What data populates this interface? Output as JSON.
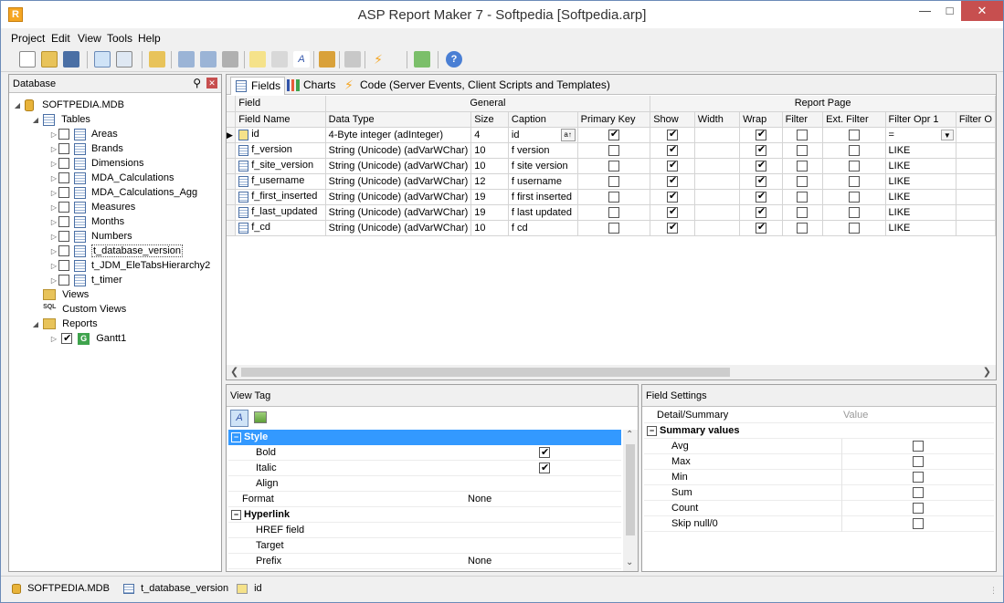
{
  "window": {
    "title": "ASP Report Maker 7 - Softpedia [Softpedia.arp]"
  },
  "menu": [
    "Project",
    "Edit",
    "View",
    "Tools",
    "Help"
  ],
  "left_panel": {
    "title": "Database",
    "root": "SOFTPEDIA.MDB",
    "tables_label": "Tables",
    "tables": [
      "Areas",
      "Brands",
      "Dimensions",
      "MDA_Calculations",
      "MDA_Calculations_Agg",
      "Measures",
      "Months",
      "Numbers",
      "t_database_version",
      "t_JDM_EleTabsHierarchy2",
      "t_timer"
    ],
    "views_label": "Views",
    "custom_views_label": "Custom Views",
    "reports_label": "Reports",
    "reports": [
      "Gantt1"
    ],
    "sql_icon_text": "SQL",
    "report_badge": "G"
  },
  "tabs": [
    {
      "label": "Fields"
    },
    {
      "label": "Charts"
    },
    {
      "label": "Code (Server Events, Client Scripts and Templates)"
    }
  ],
  "grid": {
    "group_headers": {
      "field": "Field",
      "general": "General",
      "report_page": "Report Page"
    },
    "columns": [
      "Field Name",
      "Data Type",
      "Size",
      "Caption",
      "Primary Key",
      "Show",
      "Width",
      "Wrap",
      "Filter",
      "Ext. Filter",
      "Filter Opr 1",
      "Filter O"
    ],
    "rows": [
      {
        "name": "id",
        "type": "4-Byte integer (adInteger)",
        "size": "4",
        "caption": "id",
        "pk": true,
        "show": true,
        "wrap": true,
        "filter": false,
        "extfilter": false,
        "opr": "="
      },
      {
        "name": "f_version",
        "type": "String (Unicode) (adVarWChar)",
        "size": "10",
        "caption": "f version",
        "pk": false,
        "show": true,
        "wrap": true,
        "filter": false,
        "extfilter": false,
        "opr": "LIKE"
      },
      {
        "name": "f_site_version",
        "type": "String (Unicode) (adVarWChar)",
        "size": "10",
        "caption": "f site version",
        "pk": false,
        "show": true,
        "wrap": true,
        "filter": false,
        "extfilter": false,
        "opr": "LIKE"
      },
      {
        "name": "f_username",
        "type": "String (Unicode) (adVarWChar)",
        "size": "12",
        "caption": "f username",
        "pk": false,
        "show": true,
        "wrap": true,
        "filter": false,
        "extfilter": false,
        "opr": "LIKE"
      },
      {
        "name": "f_first_inserted",
        "type": "String (Unicode) (adVarWChar)",
        "size": "19",
        "caption": "f first inserted",
        "pk": false,
        "show": true,
        "wrap": true,
        "filter": false,
        "extfilter": false,
        "opr": "LIKE"
      },
      {
        "name": "f_last_updated",
        "type": "String (Unicode) (adVarWChar)",
        "size": "19",
        "caption": "f last updated",
        "pk": false,
        "show": true,
        "wrap": true,
        "filter": false,
        "extfilter": false,
        "opr": "LIKE"
      },
      {
        "name": "f_cd",
        "type": "String (Unicode) (adVarWChar)",
        "size": "10",
        "caption": "f cd",
        "pk": false,
        "show": true,
        "wrap": true,
        "filter": false,
        "extfilter": false,
        "opr": "LIKE"
      }
    ]
  },
  "view_tag": {
    "title": "View Tag",
    "style_section": "Style",
    "props": [
      {
        "label": "Bold",
        "checked": true
      },
      {
        "label": "Italic",
        "checked": true
      },
      {
        "label": "Align",
        "value": ""
      }
    ],
    "format_label": "Format",
    "format_value": "None",
    "hyperlink_section": "Hyperlink",
    "hyperlink_props": [
      {
        "label": "HREF field",
        "value": ""
      },
      {
        "label": "Target",
        "value": ""
      },
      {
        "label": "Prefix",
        "value": "None"
      }
    ]
  },
  "field_settings": {
    "title": "Field Settings",
    "col1": "Detail/Summary",
    "col2": "Value",
    "section": "Summary values",
    "items": [
      "Avg",
      "Max",
      "Min",
      "Sum",
      "Count",
      "Skip null/0"
    ]
  },
  "status": [
    "SOFTPEDIA.MDB",
    "t_database_version",
    "id"
  ],
  "colors": {
    "selection": "#3399ff",
    "accent": "#f5a623",
    "close": "#c74f4f"
  }
}
